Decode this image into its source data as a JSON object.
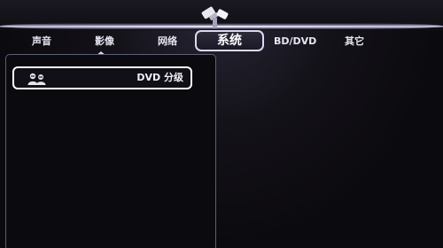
{
  "tabs": [
    {
      "label": "声音",
      "active": false
    },
    {
      "label": "影像",
      "active": false
    },
    {
      "label": "网络",
      "active": false
    },
    {
      "label": "系统",
      "active": true
    },
    {
      "label": "BD/DVD",
      "active": false
    },
    {
      "label": "其它",
      "active": false
    }
  ],
  "menu": {
    "items": [
      {
        "label": "DVD 分级",
        "icon": "parental-control-icon",
        "selected": true
      }
    ]
  },
  "colors": {
    "background": "#0b0a0e",
    "highlight": "#ffffff",
    "panel_border": "#5c6077"
  }
}
